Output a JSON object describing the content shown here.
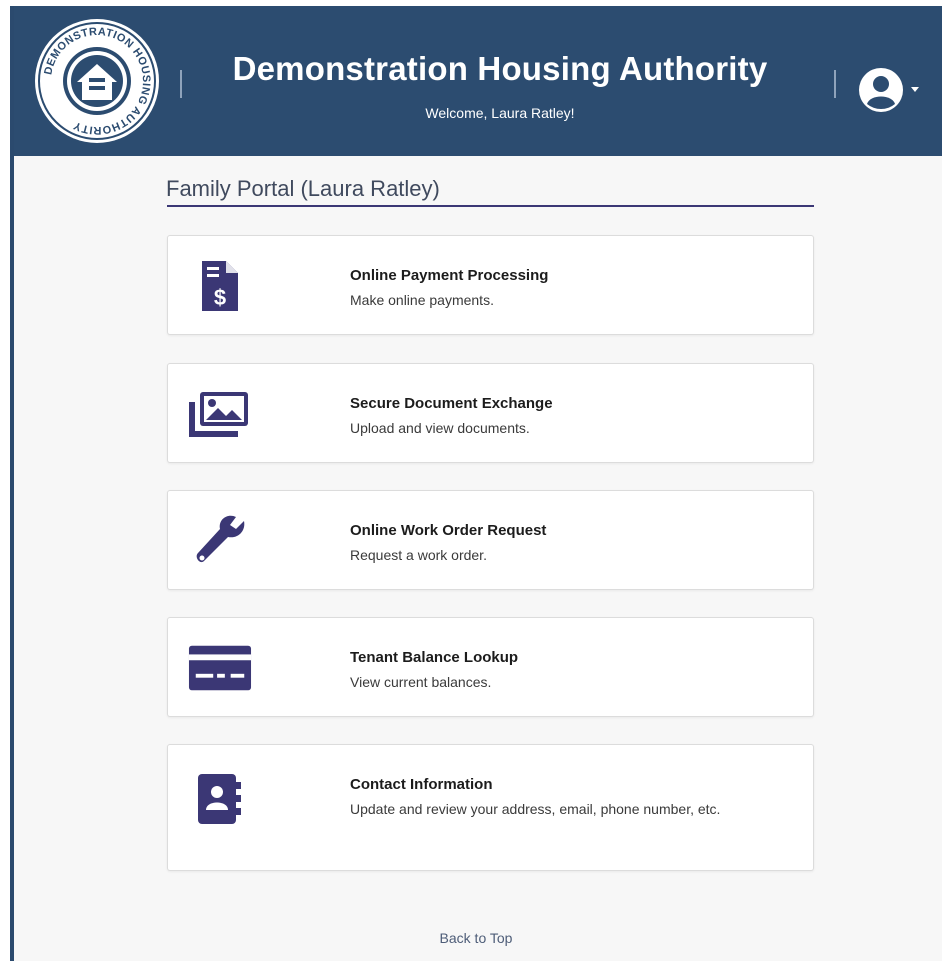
{
  "header": {
    "title": "Demonstration Housing Authority",
    "welcome": "Welcome, Laura Ratley!",
    "background_color": "#2c4c70",
    "logo_icon": "housing-authority-seal",
    "logo_text": "DEMONSTRATION HOUSING AUTHORITY",
    "user_menu_icon": "user-circle-icon"
  },
  "portal": {
    "title": "Family Portal (Laura Ratley)",
    "accent_color": "#3b3775"
  },
  "services": [
    {
      "title": "Online Payment Processing",
      "description": "Make online payments.",
      "icon": "invoice-dollar-icon"
    },
    {
      "title": "Secure Document Exchange",
      "description": "Upload and view documents.",
      "icon": "images-icon"
    },
    {
      "title": "Online Work Order Request",
      "description": "Request a work order.",
      "icon": "wrench-icon"
    },
    {
      "title": "Tenant Balance Lookup",
      "description": "View current balances.",
      "icon": "credit-card-icon"
    },
    {
      "title": "Contact Information",
      "description": "Update and review your address, email, phone number, etc.",
      "icon": "address-book-icon"
    }
  ],
  "footer": {
    "back_to_top": "Back to Top"
  }
}
